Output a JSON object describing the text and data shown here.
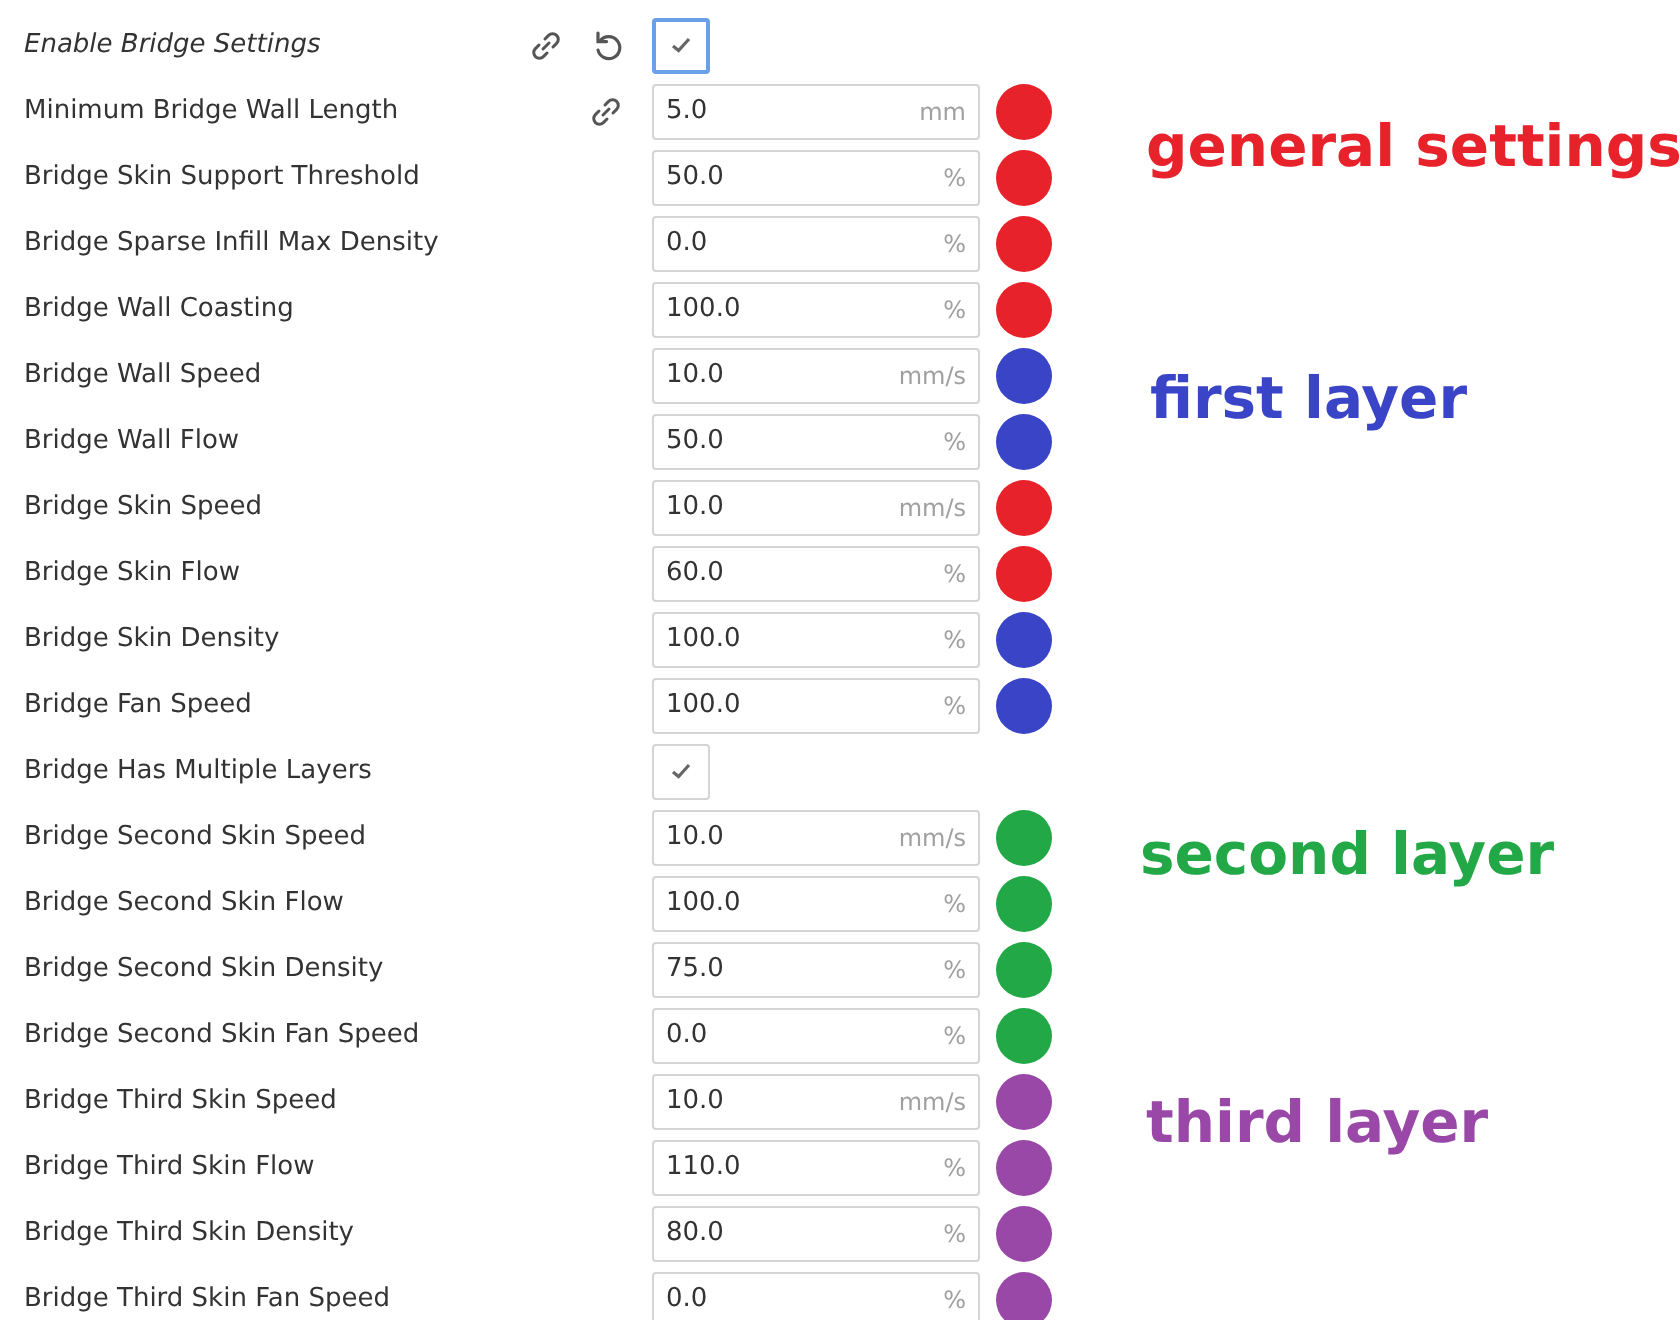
{
  "settings": [
    {
      "label": "Enable Bridge Settings",
      "kind": "checkbox",
      "checked": true,
      "focused": true,
      "modified": true,
      "link": true,
      "reset": true
    },
    {
      "label": "Minimum Bridge Wall Length",
      "kind": "field",
      "value": "5.0",
      "unit": "mm",
      "modified": false,
      "link": true,
      "reset": false,
      "color": "#e8222a"
    },
    {
      "label": "Bridge Skin Support Threshold",
      "kind": "field",
      "value": "50.0",
      "unit": "%",
      "modified": false,
      "link": false,
      "reset": false,
      "color": "#e8222a"
    },
    {
      "label": "Bridge Sparse Infill Max Density",
      "kind": "field",
      "value": "0.0",
      "unit": "%",
      "modified": false,
      "link": false,
      "reset": false,
      "color": "#e8222a"
    },
    {
      "label": "Bridge Wall Coasting",
      "kind": "field",
      "value": "100.0",
      "unit": "%",
      "modified": false,
      "link": false,
      "reset": false,
      "color": "#e8222a"
    },
    {
      "label": "Bridge Wall Speed",
      "kind": "field",
      "value": "10.0",
      "unit": "mm/s",
      "modified": false,
      "link": false,
      "reset": false,
      "color": "#3a44c6"
    },
    {
      "label": "Bridge Wall Flow",
      "kind": "field",
      "value": "50.0",
      "unit": "%",
      "modified": false,
      "link": false,
      "reset": false,
      "color": "#3a44c6"
    },
    {
      "label": "Bridge Skin Speed",
      "kind": "field",
      "value": "10.0",
      "unit": "mm/s",
      "modified": false,
      "link": false,
      "reset": false,
      "color": "#e8222a"
    },
    {
      "label": "Bridge Skin Flow",
      "kind": "field",
      "value": "60.0",
      "unit": "%",
      "modified": false,
      "link": false,
      "reset": false,
      "color": "#e8222a"
    },
    {
      "label": "Bridge Skin Density",
      "kind": "field",
      "value": "100.0",
      "unit": "%",
      "modified": false,
      "link": false,
      "reset": false,
      "color": "#3a44c6"
    },
    {
      "label": "Bridge Fan Speed",
      "kind": "field",
      "value": "100.0",
      "unit": "%",
      "modified": false,
      "link": false,
      "reset": false,
      "color": "#3a44c6"
    },
    {
      "label": "Bridge Has Multiple Layers",
      "kind": "checkbox",
      "checked": true,
      "focused": false,
      "modified": false,
      "link": false,
      "reset": false
    },
    {
      "label": "Bridge Second Skin Speed",
      "kind": "field",
      "value": "10.0",
      "unit": "mm/s",
      "modified": false,
      "link": false,
      "reset": false,
      "color": "#22a846"
    },
    {
      "label": "Bridge Second Skin Flow",
      "kind": "field",
      "value": "100.0",
      "unit": "%",
      "modified": false,
      "link": false,
      "reset": false,
      "color": "#22a846"
    },
    {
      "label": "Bridge Second Skin Density",
      "kind": "field",
      "value": "75.0",
      "unit": "%",
      "modified": false,
      "link": false,
      "reset": false,
      "color": "#22a846"
    },
    {
      "label": "Bridge Second Skin Fan Speed",
      "kind": "field",
      "value": "0.0",
      "unit": "%",
      "modified": false,
      "link": false,
      "reset": false,
      "color": "#22a846"
    },
    {
      "label": "Bridge Third Skin Speed",
      "kind": "field",
      "value": "10.0",
      "unit": "mm/s",
      "modified": false,
      "link": false,
      "reset": false,
      "color": "#9a48a8"
    },
    {
      "label": "Bridge Third Skin Flow",
      "kind": "field",
      "value": "110.0",
      "unit": "%",
      "modified": false,
      "link": false,
      "reset": false,
      "color": "#9a48a8"
    },
    {
      "label": "Bridge Third Skin Density",
      "kind": "field",
      "value": "80.0",
      "unit": "%",
      "modified": false,
      "link": false,
      "reset": false,
      "color": "#9a48a8"
    },
    {
      "label": "Bridge Third Skin Fan Speed",
      "kind": "field",
      "value": "0.0",
      "unit": "%",
      "modified": false,
      "link": false,
      "reset": false,
      "color": "#9a48a8"
    }
  ],
  "annotations": [
    {
      "text": "general settings",
      "color": "#e8222a"
    },
    {
      "text": "first layer",
      "color": "#3a44c6"
    },
    {
      "text": "second layer",
      "color": "#22a846"
    },
    {
      "text": "third layer",
      "color": "#9a48a8"
    }
  ]
}
